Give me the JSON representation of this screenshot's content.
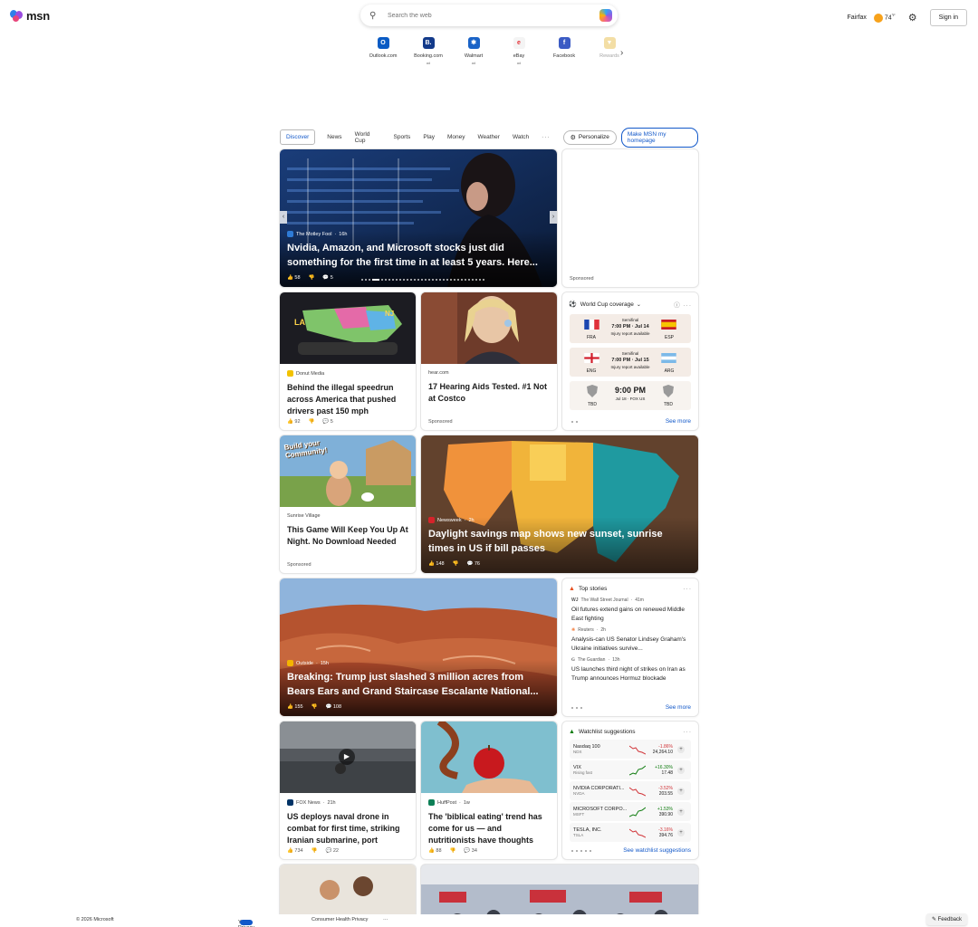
{
  "brand": {
    "logo_text": "msn"
  },
  "search": {
    "placeholder": "Search the web"
  },
  "header": {
    "location": "Fairfax",
    "temperature": "74",
    "temp_unit": "°F",
    "signin_label": "Sign in"
  },
  "quick_links": [
    {
      "label": "Outlook.com",
      "ad": "",
      "icon_color": "#0a5bc4",
      "icon_glyph": "O"
    },
    {
      "label": "Booking.com",
      "ad": "ad",
      "icon_color": "#133a8a",
      "icon_glyph": "B."
    },
    {
      "label": "Walmart",
      "ad": "ad",
      "icon_color": "#1a63c7",
      "icon_glyph": "✱"
    },
    {
      "label": "eBay",
      "ad": "ad",
      "icon_color": "#f4f4f4",
      "icon_glyph": "e"
    },
    {
      "label": "Facebook",
      "ad": "",
      "icon_color": "#3b5bc4",
      "icon_glyph": "f"
    },
    {
      "label": "Rewards",
      "ad": "",
      "icon_color": "#e6b73a",
      "icon_glyph": "▼"
    }
  ],
  "nav": {
    "tabs": [
      "Discover",
      "News",
      "World Cup",
      "Sports",
      "Play",
      "Money",
      "Weather",
      "Watch"
    ],
    "more": "···",
    "personalize": "Personalize",
    "homepage": "Make MSN my homepage"
  },
  "hero": {
    "source": "The Motley Fool",
    "time": "16h",
    "title": "Nvidia, Amazon, and Microsoft stocks just did something for the first time in at least 5 years. Here...",
    "likes": "58",
    "comments": "5"
  },
  "ad_tile": {
    "label": "Sponsored"
  },
  "card_speed": {
    "source": "Donut Media",
    "title": "Behind the illegal speedrun across America that pushed drivers past 150 mph",
    "likes": "92",
    "comments": "5"
  },
  "card_hearing": {
    "source": "hear.com",
    "title": "17 Hearing Aids Tested. #1 Not at Costco",
    "sponsored": "Sponsored"
  },
  "world_cup": {
    "title": "World Cup coverage",
    "matches": [
      {
        "home": "FRA",
        "away": "ESP",
        "stage": "Semifinal",
        "time": "7:00 PM · Jul 14",
        "note": "Injury report available"
      },
      {
        "home": "ENG",
        "away": "ARG",
        "stage": "Semifinal",
        "time": "7:00 PM · Jul 15",
        "note": "Injury report available"
      },
      {
        "home": "TBD",
        "away": "TBD",
        "stage": "",
        "time": "9:00 PM",
        "note": "Jul 18 · FOX US"
      }
    ],
    "see_more": "See more"
  },
  "card_game": {
    "source": "Sunrise Village",
    "title": "This Game Will Keep You Up At Night. No Download Needed",
    "sponsored": "Sponsored",
    "banner": "Build your Community!"
  },
  "card_map": {
    "source": "Newsweek",
    "time": "2h",
    "title": "Daylight savings map shows new sunset, sunrise times in US if bill passes",
    "likes": "148",
    "comments": "76"
  },
  "card_trump": {
    "source": "Outside",
    "time": "15h",
    "title": "Breaking: Trump just slashed 3 million acres from Bears Ears and Grand Staircase Escalante National...",
    "likes": "155",
    "comments": "108"
  },
  "top_stories": {
    "title": "Top stories",
    "items": [
      {
        "source": "The Wall Street Journal",
        "time": "41m",
        "title": "Oil futures extend gains on renewed Middle East fighting"
      },
      {
        "source": "Reuters",
        "time": "2h",
        "title": "Analysis-can US Senator Lindsey Graham's Ukraine initiatives survive..."
      },
      {
        "source": "The Guardian",
        "time": "13h",
        "title": "US launches third night of strikes on Iran as Trump announces Hormuz blockade"
      }
    ],
    "see_more": "See more"
  },
  "card_drone": {
    "source": "FOX News",
    "time": "21h",
    "title": "US deploys naval drone in combat for first time, striking Iranian submarine, port",
    "likes": "734",
    "comments": "22"
  },
  "card_diet": {
    "source": "HuffPost",
    "time": "1w",
    "title": "The 'biblical eating' trend has come for us — and nutritionists have thoughts",
    "likes": "88",
    "comments": "34"
  },
  "watchlist": {
    "title": "Watchlist suggestions",
    "stocks": [
      {
        "name": "Nasdaq 100",
        "ticker": "NDX",
        "change": "-1.86%",
        "price": "24,264.10",
        "trend": "down"
      },
      {
        "name": "VIX",
        "ticker": "Rising fast",
        "change": "+16.30%",
        "price": "17.48",
        "trend": "up"
      },
      {
        "name": "NVIDIA CORPORATI...",
        "ticker": "NVDA",
        "change": "-3.52%",
        "price": "203.55",
        "trend": "down"
      },
      {
        "name": "MICROSOFT CORPO...",
        "ticker": "MSFT",
        "change": "+1.53%",
        "price": "390.90",
        "trend": "up"
      },
      {
        "name": "TESLA, INC.",
        "ticker": "TSLA",
        "change": "-3.16%",
        "price": "394.76",
        "trend": "down"
      }
    ],
    "see_more": "See watchlist suggestions"
  },
  "footer": {
    "copyright": "© 2026 Microsoft",
    "privacy": "Your Privacy Choices",
    "health": "Consumer Health Privacy",
    "more": "···",
    "feedback": "Feedback"
  },
  "colors": {
    "accent": "#1258c9",
    "down": "#d13438",
    "up": "#107c10"
  }
}
